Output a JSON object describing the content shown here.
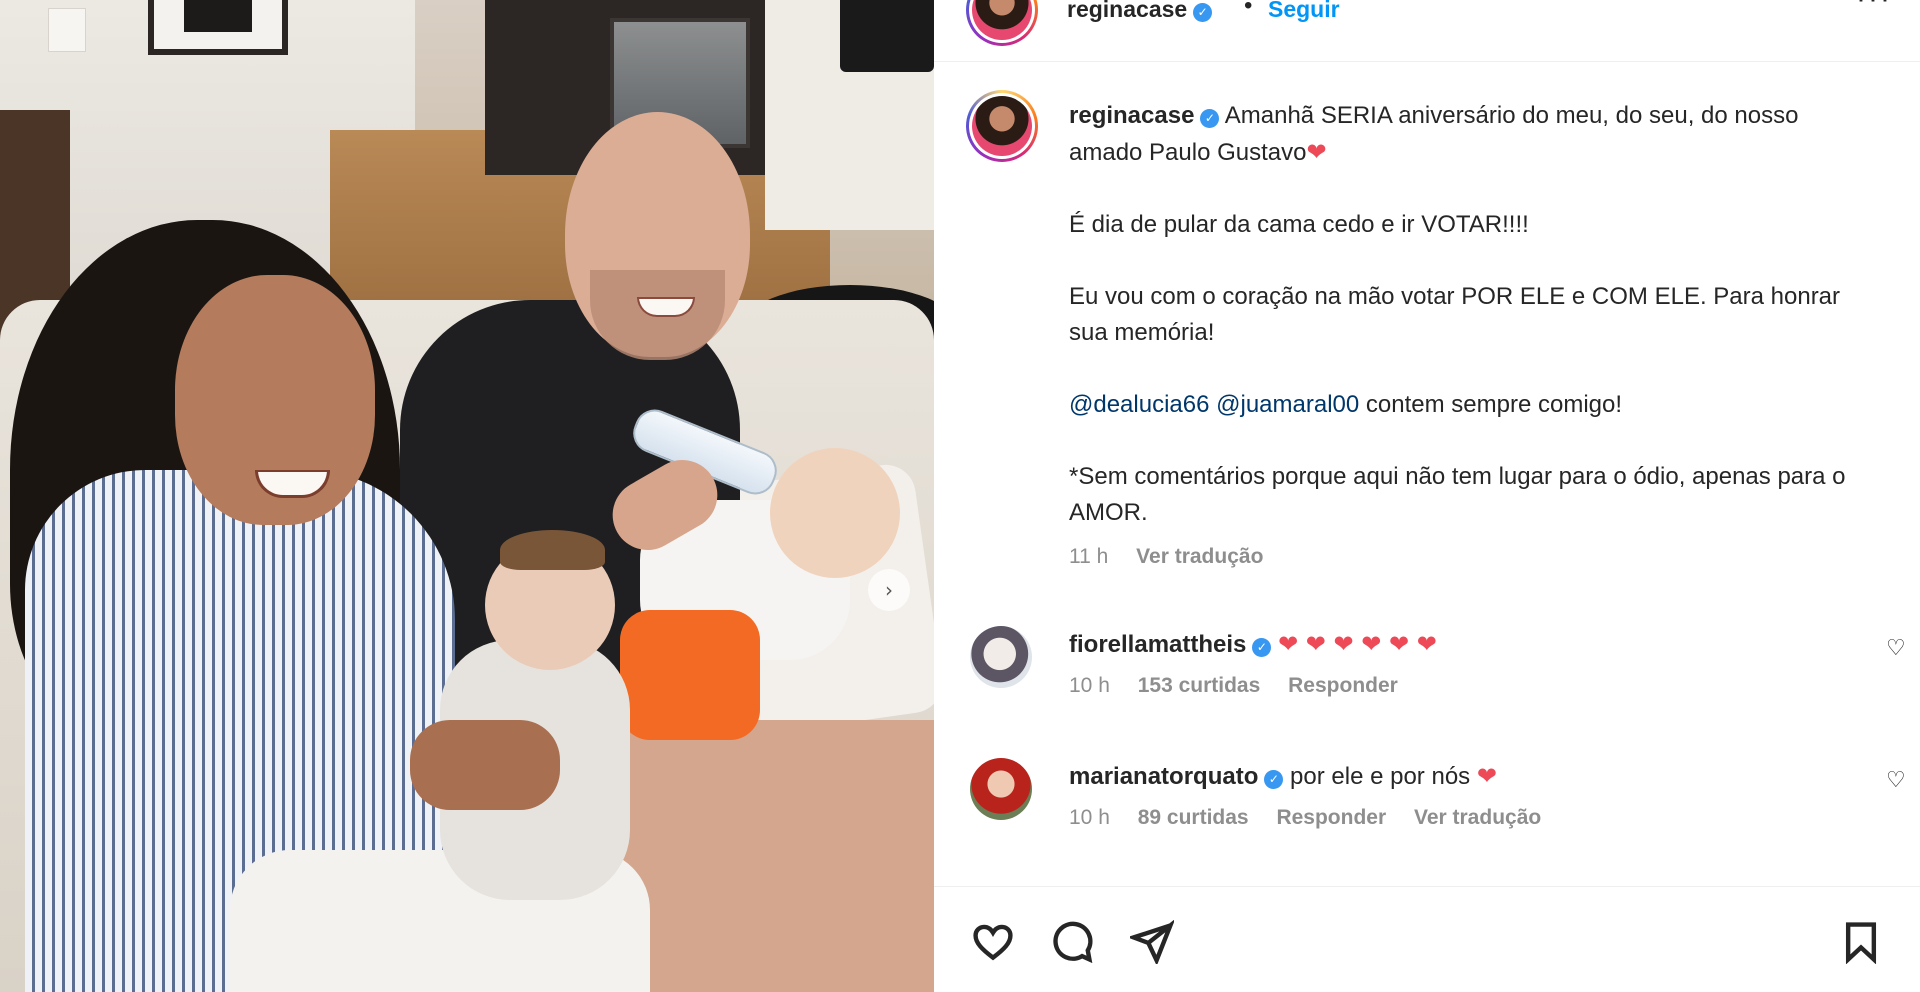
{
  "photo": {
    "alt_controls": {
      "next_icon": "chevron-right-icon"
    }
  },
  "header": {
    "username": "reginacase",
    "separator": "•",
    "follow_label": "Seguir",
    "more_icon": "more-horizontal-icon"
  },
  "caption": {
    "username": "reginacase",
    "line1": "Amanhã SERIA aniversário do meu, do seu, do nosso amado Paulo Gustavo",
    "line2": "É dia de pular da cama cedo e ir VOTAR!!!!",
    "line3": "Eu vou com o coração na mão votar POR ELE e COM ELE. Para honrar sua memória!",
    "mention1": "@dealucia66",
    "mention2": "@juamaral00",
    "line4_rest": "contem sempre comigo!",
    "line5": "*Sem comentários porque aqui não tem lugar para o ódio, apenas para o AMOR.",
    "time": "11 h",
    "translate": "Ver tradução"
  },
  "comments": [
    {
      "username": "fiorellamattheis",
      "text": "❤ ❤ ❤ ❤ ❤ ❤",
      "time": "10 h",
      "likes": "153 curtidas",
      "reply": "Responder"
    },
    {
      "username": "marianatorquato",
      "text": "por ele e por nós",
      "emoji": "❤",
      "time": "10 h",
      "likes": "89 curtidas",
      "reply": "Responder",
      "translate": "Ver tradução"
    }
  ],
  "symbols": {
    "verified": "✓",
    "heart": "❤",
    "heart_outline": "♡",
    "chevron": "›",
    "more": "···"
  },
  "actions": {
    "like_icon": "heart-icon",
    "comment_icon": "comment-icon",
    "share_icon": "send-icon",
    "save_icon": "bookmark-icon"
  },
  "colors": {
    "link": "#0095f6",
    "mention": "#00376b",
    "verified": "#3897f0",
    "heart": "#ed4956",
    "meta": "#8e8e8e"
  }
}
